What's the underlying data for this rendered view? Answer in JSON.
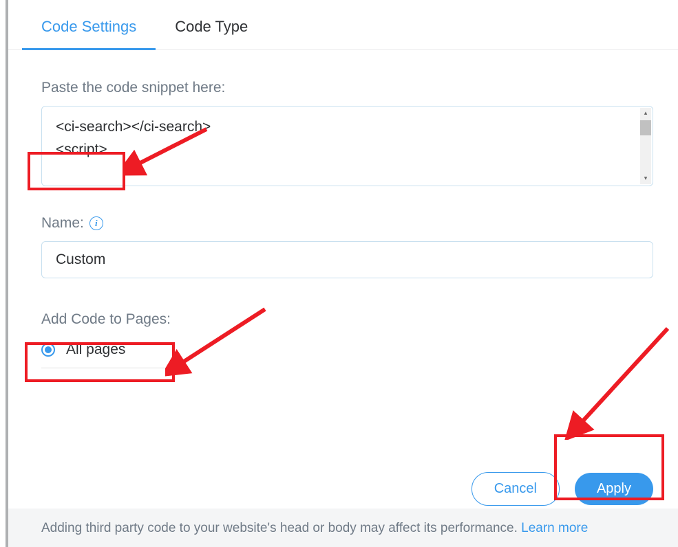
{
  "tabs": {
    "settings": "Code Settings",
    "type": "Code Type"
  },
  "form": {
    "snippet_label": "Paste the code snippet here:",
    "snippet_line1": "<ci-search></ci-search>",
    "snippet_line2": "<script>",
    "name_label": "Name:",
    "name_value": "Custom",
    "pages_label": "Add Code to Pages:",
    "pages_option_all": "All pages"
  },
  "buttons": {
    "cancel": "Cancel",
    "apply": "Apply"
  },
  "footer": {
    "text": "Adding third party code to your website's head or body may affect its performance. ",
    "link": "Learn more"
  }
}
